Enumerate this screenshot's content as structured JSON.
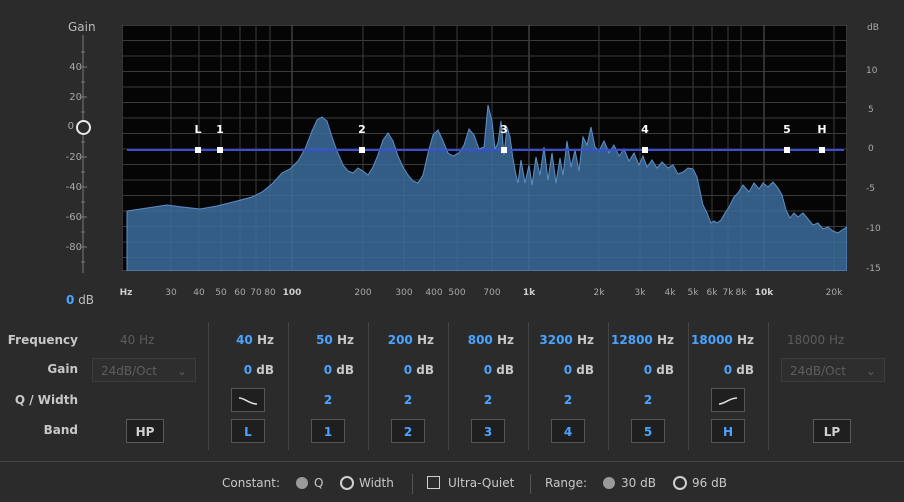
{
  "window": {
    "left_axis_title": "Gain",
    "gain_value": "0",
    "gain_unit": "dB",
    "right_axis_title": "dB"
  },
  "left_axis_ticks": [
    "40",
    "20",
    "0",
    "-20",
    "-40",
    "-60",
    "-80"
  ],
  "right_axis_ticks": [
    "10",
    "5",
    "0",
    "-5",
    "-10",
    "-15"
  ],
  "freq_axis_ticks": [
    "Hz",
    "30",
    "40",
    "50",
    "60",
    "70",
    "80",
    "100",
    "200",
    "300",
    "400",
    "500",
    "700",
    "1k",
    "2k",
    "3k",
    "4k",
    "5k",
    "6k",
    "7k",
    "8k",
    "10k",
    "20k"
  ],
  "curve_handles": [
    "L",
    "1",
    "2",
    "3",
    "4",
    "5",
    "H"
  ],
  "row_labels": {
    "frequency": "Frequency",
    "gain": "Gain",
    "q": "Q / Width",
    "band": "Band"
  },
  "highpass": {
    "freq": "40 Hz",
    "slope": "24dB/Oct",
    "button": "HP"
  },
  "lowpass": {
    "freq": "18000 Hz",
    "slope": "24dB/Oct",
    "button": "LP"
  },
  "bands": [
    {
      "freq": "40",
      "gain": "0",
      "q": "",
      "button": "L"
    },
    {
      "freq": "50",
      "gain": "0",
      "q": "2",
      "button": "1"
    },
    {
      "freq": "200",
      "gain": "0",
      "q": "2",
      "button": "2"
    },
    {
      "freq": "800",
      "gain": "0",
      "q": "2",
      "button": "3"
    },
    {
      "freq": "3200",
      "gain": "0",
      "q": "2",
      "button": "4"
    },
    {
      "freq": "12800",
      "gain": "0",
      "q": "2",
      "button": "5"
    },
    {
      "freq": "18000",
      "gain": "0",
      "q": "",
      "button": "H"
    }
  ],
  "units": {
    "hz": "Hz",
    "db": "dB"
  },
  "footer": {
    "constant_label": "Constant:",
    "q_label": "Q",
    "width_label": "Width",
    "ultra_quiet_label": "Ultra-Quiet",
    "range_label": "Range:",
    "range30": "30 dB",
    "range96": "96 dB"
  },
  "colors": {
    "accent": "#4aa3ff",
    "curve": "#3a4fd8",
    "spectrum": "#3d6d9e"
  }
}
